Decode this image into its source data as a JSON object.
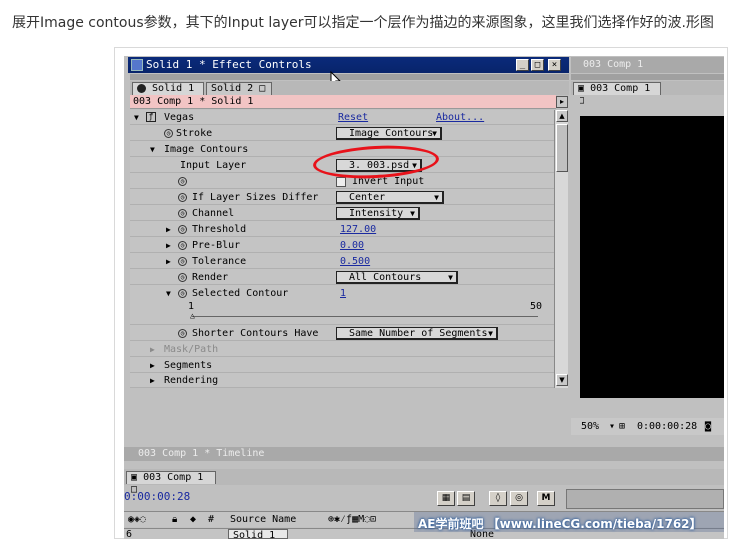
{
  "caption": "展开Image contous参数，其下的Input layer可以指定一个层作为描边的来源图象，这里我们选择作好的波.形图",
  "effect_window": {
    "title": "Solid 1 * Effect Controls",
    "tabs": [
      "Solid 1",
      "Solid 2"
    ],
    "subheader": "003 Comp 1 * Solid 1",
    "effect_name": "Vegas",
    "reset": "Reset",
    "about": "About...",
    "rows": {
      "stroke": {
        "label": "Stroke",
        "value": "Image Contours"
      },
      "image_contours": {
        "label": "Image Contours"
      },
      "input_layer": {
        "label": "Input Layer",
        "value": "3. 003.psd"
      },
      "invert_input": {
        "label": "Invert Input"
      },
      "if_layer_sizes": {
        "label": "If Layer Sizes Differ",
        "value": "Center"
      },
      "channel": {
        "label": "Channel",
        "value": "Intensity"
      },
      "threshold": {
        "label": "Threshold",
        "value": "127.00"
      },
      "pre_blur": {
        "label": "Pre-Blur",
        "value": "0.00"
      },
      "tolerance": {
        "label": "Tolerance",
        "value": "0.500"
      },
      "render": {
        "label": "Render",
        "value": "All Contours"
      },
      "selected_contour": {
        "label": "Selected Contour",
        "value": "1"
      },
      "slider": {
        "min": "1",
        "max": "50"
      },
      "shorter_contours": {
        "label": "Shorter Contours Have",
        "value": "Same Number of Segments"
      },
      "mask_path": {
        "label": "Mask/Path"
      },
      "segments": {
        "label": "Segments"
      },
      "rendering": {
        "label": "Rendering"
      }
    }
  },
  "comp_window": {
    "title": "003 Comp 1",
    "tab": "003 Comp 1",
    "zoom": "50%",
    "timecode": "0:00:00:28"
  },
  "timeline": {
    "title": "003 Comp 1 * Timeline",
    "tab": "003 Comp 1",
    "time": "0:00:00:28",
    "col_source": "Source Name",
    "layer_num": "6",
    "layer_name": "Solid 1",
    "mode": "None",
    "mode_btn": "M"
  },
  "watermark": "AE学前班吧 【www.lineCG.com/tieba/1762】",
  "colors": {
    "highlight_circle": "#e8121a",
    "titlebar_active": "#0a2a7a",
    "link_blue": "#1a2aa0",
    "subheader_pink": "#f2c4c4"
  }
}
